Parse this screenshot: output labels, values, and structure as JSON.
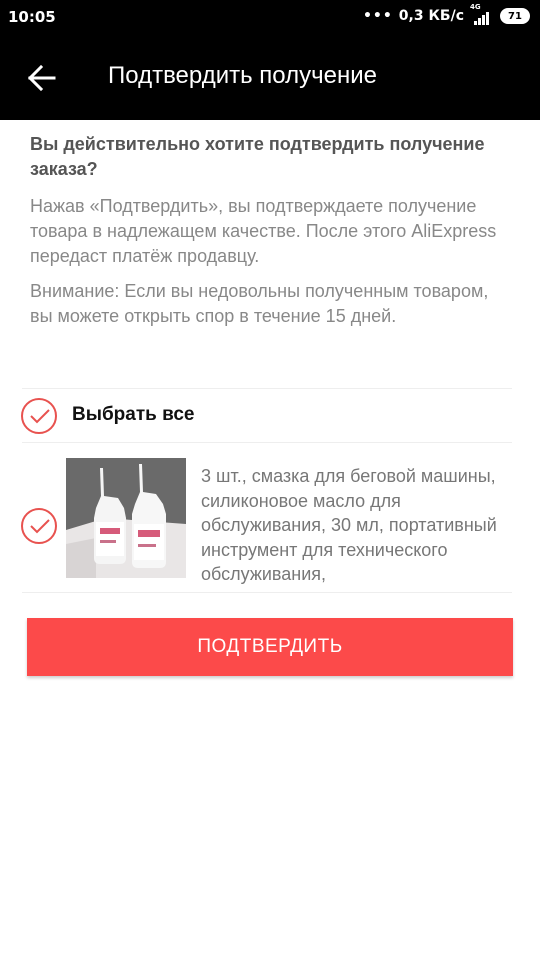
{
  "status_bar": {
    "time": "10:05",
    "network_speed": "0,3 КБ/с",
    "network_type": "4G",
    "battery": "71",
    "icons": [
      "signal-dots-icon",
      "network-bars-icon",
      "battery-icon"
    ]
  },
  "app_bar": {
    "title": "Подтвердить получение",
    "back_icon": "arrow-left-icon"
  },
  "main": {
    "question": "Вы действительно хотите подтвердить получение заказа?",
    "paragraph_1": "Нажав «Подтвердить», вы подтверждаете получение товара в надлежащем качестве. После этого AliExpress передаст платёж продавцу.",
    "paragraph_2": "Внимание: Если вы недовольны полученным товаром, вы можете открыть спор в течение 15 дней."
  },
  "select_all": {
    "label": "Выбрать все",
    "checked": true
  },
  "items": [
    {
      "title": "3 шт., смазка для беговой машины, силиконовое масло для обслуживания, 30 мл, портативный инструмент для технического обслуживания,",
      "checked": true
    }
  ],
  "confirm_button": {
    "label": "ПОДТВЕРДИТЬ"
  },
  "colors": {
    "accent": "#fc4a4a",
    "check": "#e8524f",
    "bar": "#000000"
  }
}
